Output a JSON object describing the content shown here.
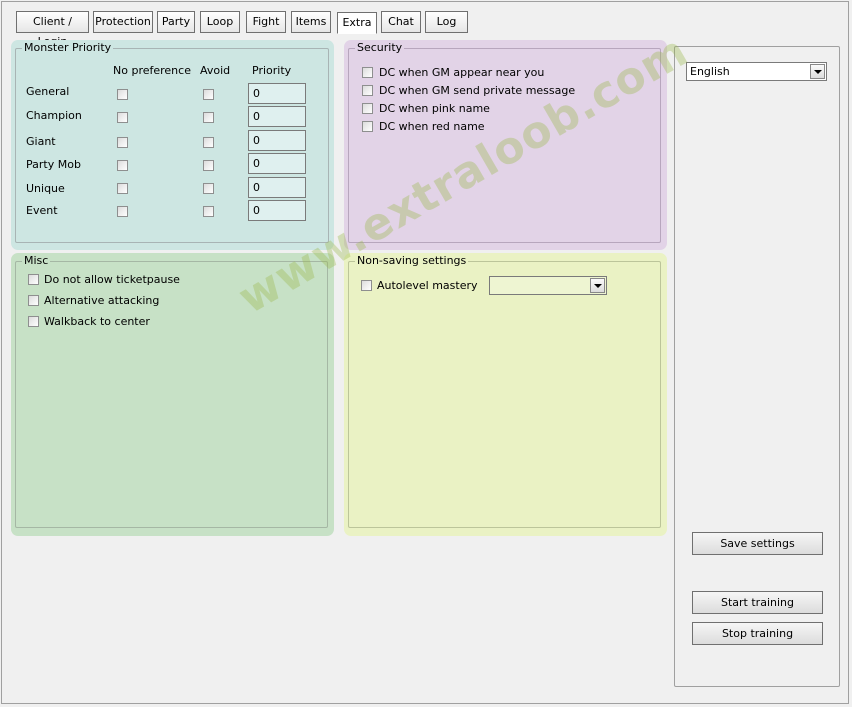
{
  "tabs": [
    {
      "label": "Client / Login"
    },
    {
      "label": "Protection"
    },
    {
      "label": "Party"
    },
    {
      "label": "Loop"
    },
    {
      "label": "Fight"
    },
    {
      "label": "Items"
    },
    {
      "label": "Extra"
    },
    {
      "label": "Chat"
    },
    {
      "label": "Log"
    }
  ],
  "active_tab": "Extra",
  "monster_priority": {
    "legend": "Monster Priority",
    "headers": {
      "no_preference": "No preference",
      "avoid": "Avoid",
      "priority": "Priority"
    },
    "rows": [
      {
        "label": "General",
        "priority": "0"
      },
      {
        "label": "Champion",
        "priority": "0"
      },
      {
        "label": "Giant",
        "priority": "0"
      },
      {
        "label": "Party Mob",
        "priority": "0"
      },
      {
        "label": "Unique",
        "priority": "0"
      },
      {
        "label": "Event",
        "priority": "0"
      }
    ]
  },
  "security": {
    "legend": "Security",
    "items": [
      {
        "label": "DC when GM appear near you"
      },
      {
        "label": "DC when GM send private message"
      },
      {
        "label": "DC when pink name"
      },
      {
        "label": "DC when red name"
      }
    ]
  },
  "misc": {
    "legend": "Misc",
    "items": [
      {
        "label": "Do not allow ticketpause"
      },
      {
        "label": "Alternative attacking"
      },
      {
        "label": "Walkback to center"
      }
    ]
  },
  "non_saving": {
    "legend": "Non-saving settings",
    "autolevel_label": "Autolevel mastery",
    "autolevel_value": ""
  },
  "sidebar": {
    "language": "English",
    "save_label": "Save settings",
    "start_label": "Start training",
    "stop_label": "Stop training"
  },
  "watermark": "www.extraloob.com",
  "colors": {
    "monster_panel": "#cde6e2",
    "security_panel": "#e2d3e7",
    "misc_panel": "#c7e1c6",
    "nonsaving_panel": "#eaf2c4"
  }
}
